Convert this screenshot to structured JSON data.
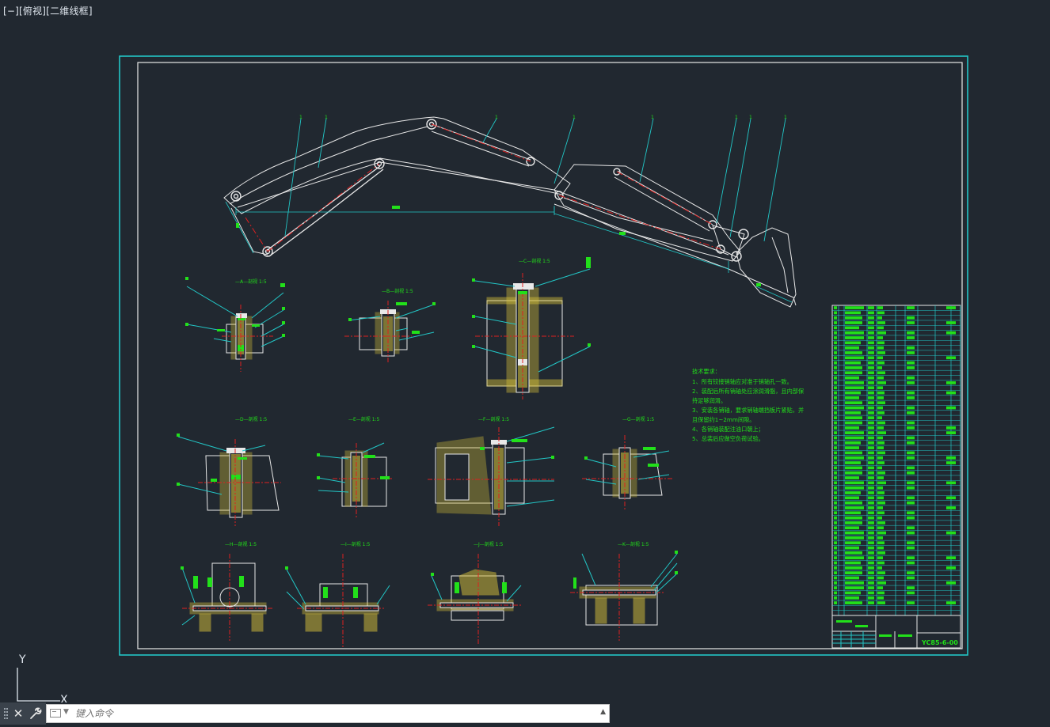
{
  "viewport": {
    "label": "[−][俯视][二维线框]"
  },
  "ucs": {
    "y_label": "Y",
    "x_label": "X"
  },
  "command_line": {
    "placeholder": "键入命令",
    "history_icon": "triangle-up-icon",
    "prompt_icon": "command-prompt-icon"
  },
  "colors": {
    "background": "#212830",
    "border_outer": "#22c6c6",
    "border_inner": "#e8e8e8",
    "linework": "#e8e8e8",
    "leaders": "#22c6c6",
    "text": "#22e01a",
    "hatch": "#d8c23a",
    "centerline": "#e02020"
  },
  "drawing": {
    "tech_requirements": [
      "技术要求：",
      "1、所有铰接销轴应对准于销轴孔一致。",
      "2、装配后所有销轴处应涂润滑脂，且内部保",
      "持足够润滑。",
      "3、安装各销轴，要求销轴端挡板片紧贴，并",
      "且保留约1~2mm间隙。",
      "4、各销轴装配注油口朝上；",
      "5、总装后应做空负荷试验。"
    ],
    "drawing_number": "YC85-6-00"
  }
}
